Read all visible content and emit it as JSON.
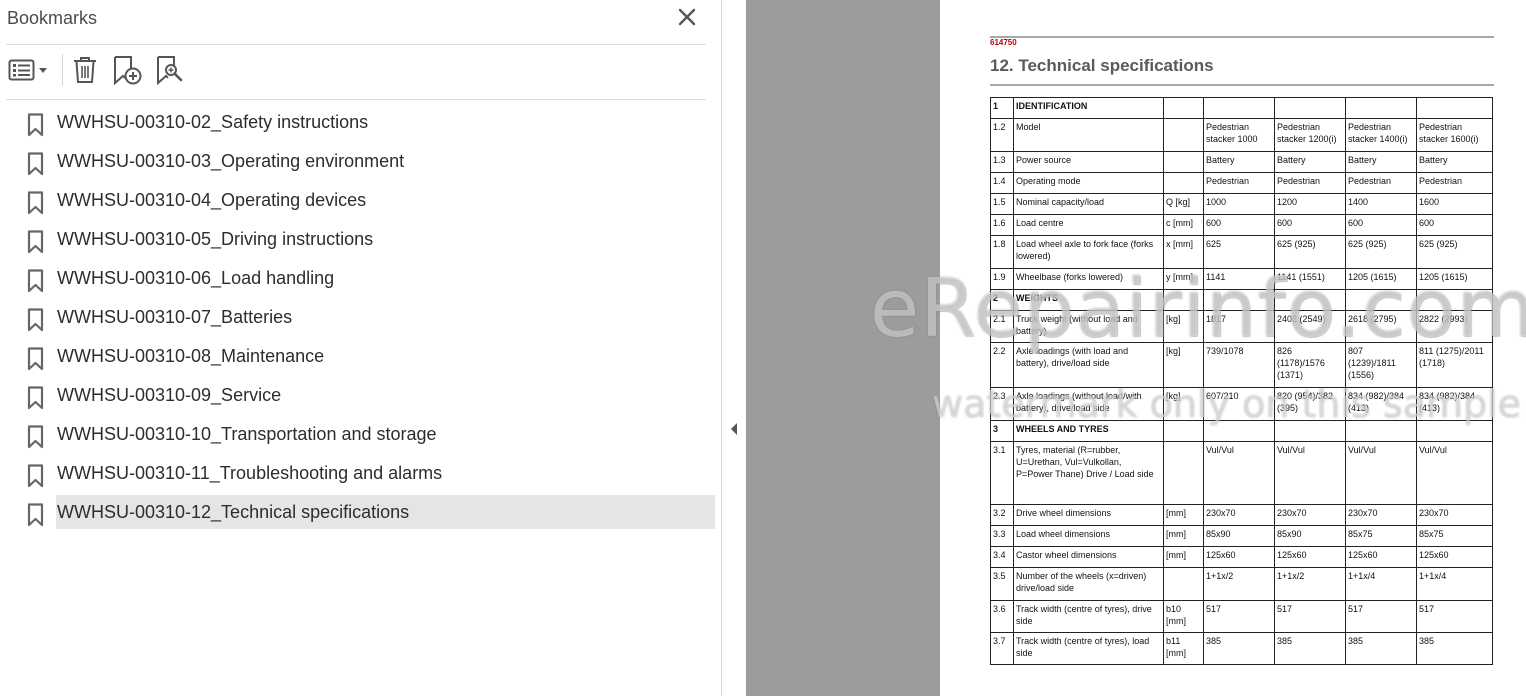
{
  "bookmarks_panel": {
    "title": "Bookmarks",
    "items": [
      {
        "label": "WWHSU-00310-02_Safety instructions"
      },
      {
        "label": "WWHSU-00310-03_Operating environment"
      },
      {
        "label": "WWHSU-00310-04_Operating devices"
      },
      {
        "label": "WWHSU-00310-05_Driving instructions"
      },
      {
        "label": "WWHSU-00310-06_Load handling"
      },
      {
        "label": "WWHSU-00310-07_Batteries"
      },
      {
        "label": "WWHSU-00310-08_Maintenance"
      },
      {
        "label": "WWHSU-00310-09_Service"
      },
      {
        "label": "WWHSU-00310-10_Transportation and storage"
      },
      {
        "label": "WWHSU-00310-11_Troubleshooting and alarms"
      },
      {
        "label": "WWHSU-00310-12_Technical specifications"
      }
    ],
    "selected_index": 10,
    "icons": {
      "close": "close-icon",
      "options": "list-options-icon",
      "delete": "trash-icon",
      "add": "add-bookmark-icon",
      "find": "find-bookmark-icon",
      "bookmark": "bookmark-icon",
      "collapse": "triangle-left-icon"
    }
  },
  "document": {
    "doc_id": "614750",
    "heading": "12. Technical specifications",
    "rows": [
      {
        "type": "section",
        "num": "1",
        "label": "IDENTIFICATION"
      },
      {
        "type": "data",
        "num": "1.2",
        "label": "Model",
        "unit": "",
        "values": [
          "Pedestrian stacker 1000",
          "Pedestrian stacker 1200(i)",
          "Pedestrian stacker 1400(i)",
          "Pedestrian stacker 1600(i)"
        ]
      },
      {
        "type": "data",
        "num": "1.3",
        "label": "Power source",
        "unit": "",
        "values": [
          "Battery",
          "Battery",
          "Battery",
          "Battery"
        ]
      },
      {
        "type": "data",
        "num": "1.4",
        "label": "Operating mode",
        "unit": "",
        "values": [
          "Pedestrian",
          "Pedestrian",
          "Pedestrian",
          "Pedestrian"
        ]
      },
      {
        "type": "data",
        "num": "1.5",
        "label": "Nominal capacity/load",
        "unit": "Q [kg]",
        "values": [
          "1000",
          "1200",
          "1400",
          "1600"
        ]
      },
      {
        "type": "data",
        "num": "1.6",
        "label": "Load centre",
        "unit": "c [mm]",
        "values": [
          "600",
          "600",
          "600",
          "600"
        ]
      },
      {
        "type": "data",
        "num": "1.8",
        "label": "Load wheel axle to fork face (forks lowered)",
        "unit": "x [mm]",
        "values": [
          "625",
          "625 (925)",
          "625 (925)",
          "625 (925)"
        ]
      },
      {
        "type": "data",
        "num": "1.9",
        "label": "Wheelbase (forks lowered)",
        "unit": "y [mm]",
        "values": [
          "1141",
          "1141 (1551)",
          "1205 (1615)",
          "1205 (1615)"
        ]
      },
      {
        "type": "section",
        "num": "2",
        "label": "WEIGHTS"
      },
      {
        "type": "data",
        "num": "2.1",
        "label": "Truck weight (without load and battery)",
        "unit": "[kg]",
        "values": [
          "1817",
          "2402 (2549)",
          "2618 (2795)",
          "2822 (2993)"
        ]
      },
      {
        "type": "data",
        "num": "2.2",
        "label": "Axle loadings (with load and battery), drive/load side",
        "unit": "[kg]",
        "values": [
          "739/1078",
          "826 (1178)/1576 (1371)",
          "807 (1239)/1811 (1556)",
          "811 (1275)/2011 (1718)"
        ]
      },
      {
        "type": "data",
        "num": "2.3",
        "label": "Axle loadings (without load/with battery), drive/load side",
        "unit": "[kg]",
        "values": [
          "607/210",
          "820 (954)/382 (395)",
          "834 (982)/384 (413)",
          "834 (982)/384 (413)"
        ]
      },
      {
        "type": "section",
        "num": "3",
        "label": "WHEELS AND TYRES"
      },
      {
        "type": "data",
        "num": "3.1",
        "label": "Tyres, material (R=rubber, U=Urethan, Vul=Vulkollan, P=Power Thane) Drive / Load side",
        "unit": "",
        "values": [
          "Vul/Vul",
          "Vul/Vul",
          "Vul/Vul",
          "Vul/Vul"
        ]
      },
      {
        "type": "data",
        "num": "3.2",
        "label": "Drive wheel dimensions",
        "unit": "[mm]",
        "values": [
          "230x70",
          "230x70",
          "230x70",
          "230x70"
        ]
      },
      {
        "type": "data",
        "num": "3.3",
        "label": "Load wheel dimensions",
        "unit": "[mm]",
        "values": [
          "85x90",
          "85x90",
          "85x75",
          "85x75"
        ]
      },
      {
        "type": "data",
        "num": "3.4",
        "label": "Castor wheel dimensions",
        "unit": "[mm]",
        "values": [
          "125x60",
          "125x60",
          "125x60",
          "125x60"
        ]
      },
      {
        "type": "data",
        "num": "3.5",
        "label": "Number of the wheels (x=driven) drive/load side",
        "unit": "",
        "values": [
          "1+1x/2",
          "1+1x/2",
          "1+1x/4",
          "1+1x/4"
        ]
      },
      {
        "type": "data",
        "num": "3.6",
        "label": "Track width (centre of tyres), drive side",
        "unit": "b10 [mm]",
        "values": [
          "517",
          "517",
          "517",
          "517"
        ]
      },
      {
        "type": "data",
        "num": "3.7",
        "label": "Track width (centre of tyres), load side",
        "unit": "b11 [mm]",
        "values": [
          "385",
          "385",
          "385",
          "385"
        ]
      }
    ]
  },
  "watermark": {
    "main": "eRepairinfo.com",
    "sub": "watermark only on this sample"
  },
  "colors": {
    "selected_bg": "#e5e5e5",
    "doc_id_red": "#c00000",
    "gutter_gray": "#9c9c9c"
  }
}
